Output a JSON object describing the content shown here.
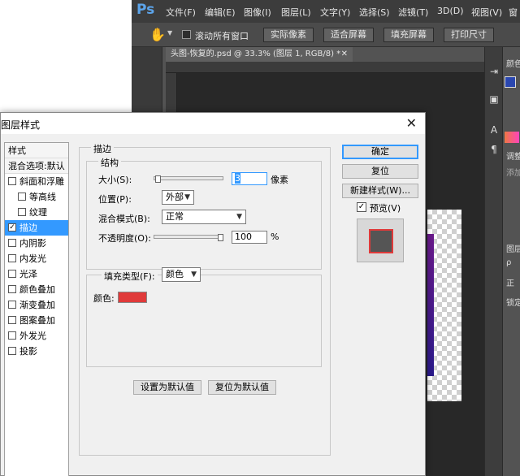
{
  "photoshop": {
    "logo": "Ps",
    "menu": [
      "文件(F)",
      "编辑(E)",
      "图像(I)",
      "图层(L)",
      "文字(Y)",
      "选择(S)",
      "滤镜(T)",
      "3D(D)",
      "视图(V)",
      "窗"
    ],
    "options_bar": {
      "scroll_all_label": "滚动所有窗口",
      "actual_pixels": "实际像素",
      "fit_screen": "适合屏幕",
      "fill_screen": "填充屏幕",
      "print_size": "打印尺寸"
    },
    "document_tab": "头图-恢复的.psd @ 33.3% (图层 1, RGB/8) *",
    "right_panel": {
      "color_label": "颜色",
      "adjust_label": "调整",
      "add_label": "添加",
      "layers_label": "图层",
      "p_label": "ρ",
      "normal_label": "正",
      "lock_label": "锁定"
    }
  },
  "dialog": {
    "title": "图层样式",
    "style_list": [
      {
        "label": "样式",
        "type": "header"
      },
      {
        "label": "混合选项:默认",
        "type": "header"
      },
      {
        "label": "斜面和浮雕",
        "checked": false,
        "indent": false
      },
      {
        "label": "等高线",
        "checked": false,
        "indent": true
      },
      {
        "label": "纹理",
        "checked": false,
        "indent": true
      },
      {
        "label": "描边",
        "checked": true,
        "indent": false,
        "selected": true
      },
      {
        "label": "内阴影",
        "checked": false,
        "indent": false
      },
      {
        "label": "内发光",
        "checked": false,
        "indent": false
      },
      {
        "label": "光泽",
        "checked": false,
        "indent": false
      },
      {
        "label": "颜色叠加",
        "checked": false,
        "indent": false
      },
      {
        "label": "渐变叠加",
        "checked": false,
        "indent": false
      },
      {
        "label": "图案叠加",
        "checked": false,
        "indent": false
      },
      {
        "label": "外发光",
        "checked": false,
        "indent": false
      },
      {
        "label": "投影",
        "checked": false,
        "indent": false
      }
    ],
    "stroke": {
      "group_title": "描边",
      "structure_title": "结构",
      "size_label": "大小(S):",
      "size_value": "3",
      "size_unit": "像素",
      "size_fraction": 0.02,
      "position_label": "位置(P):",
      "position_value": "外部",
      "blend_label": "混合模式(B):",
      "blend_value": "正常",
      "opacity_label": "不透明度(O):",
      "opacity_value": "100",
      "opacity_unit": "%",
      "opacity_fraction": 1.0,
      "fill_type_label": "填充类型(F):",
      "fill_type_value": "颜色",
      "color_label": "颜色:",
      "stroke_color": "#e03a3a",
      "make_default": "设置为默认值",
      "reset_default": "复位为默认值"
    },
    "buttons": {
      "ok": "确定",
      "reset": "复位",
      "new_style": "新建样式(W)...",
      "preview_label": "预览(V)"
    }
  }
}
